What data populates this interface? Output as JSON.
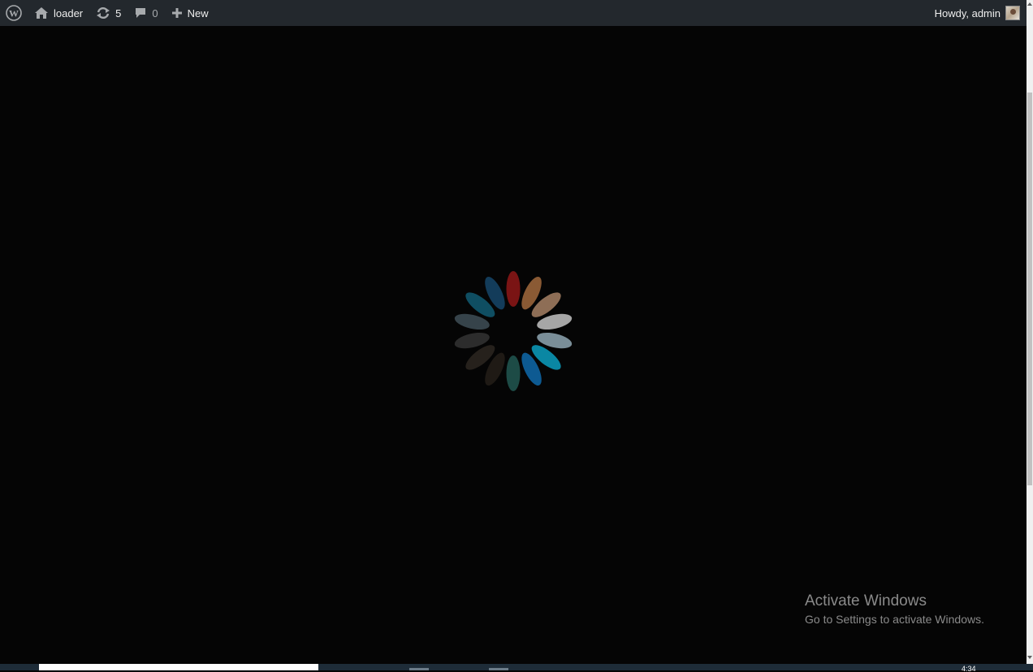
{
  "adminbar": {
    "site_name": "loader",
    "updates_count": "5",
    "comments_count": "0",
    "new_label": "New",
    "greeting": "Howdy, admin"
  },
  "spinner": {
    "colors": [
      "#7a1414",
      "#8a5a34",
      "#8e6e56",
      "#a6a6a6",
      "#7a8e98",
      "#0a87a3",
      "#0d5a92",
      "#1d4b46",
      "#1f1a15",
      "#26211c",
      "#2c2c2c",
      "#36434a",
      "#0f4e62",
      "#133c5a"
    ],
    "opacities": [
      1,
      1,
      1,
      1,
      1,
      1,
      1,
      1,
      1,
      1,
      1,
      1,
      1,
      1
    ]
  },
  "watermark": {
    "title": "Activate Windows",
    "subtitle": "Go to Settings to activate Windows."
  },
  "taskbar": {
    "clock": "4:34"
  },
  "theme": {
    "adminbar_bg": "#23282d",
    "page_bg": "#050505"
  }
}
